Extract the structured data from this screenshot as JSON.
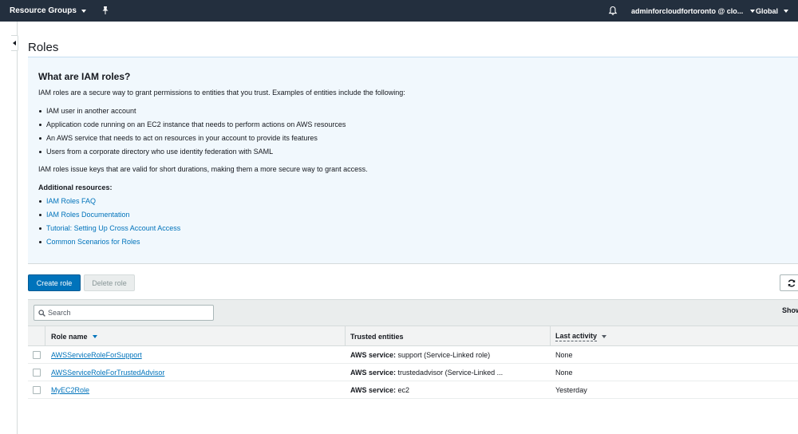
{
  "topnav": {
    "resource_groups": "Resource Groups",
    "account": "adminforcloudfortoronto @ clo...",
    "region": "Global"
  },
  "page": {
    "title": "Roles"
  },
  "info": {
    "heading": "What are IAM roles?",
    "intro": "IAM roles are a secure way to grant permissions to entities that you trust. Examples of entities include the following:",
    "entities": [
      "IAM user in another account",
      "Application code running on an EC2 instance that needs to perform actions on AWS resources",
      "An AWS service that needs to act on resources in your account to provide its features",
      "Users from a corporate directory who use identity federation with SAML"
    ],
    "keys_note": "IAM roles issue keys that are valid for short durations, making them a more secure way to grant access.",
    "resources_heading": "Additional resources:",
    "resources": [
      "IAM Roles FAQ",
      "IAM Roles Documentation",
      "Tutorial: Setting Up Cross Account Access",
      "Common Scenarios for Roles"
    ]
  },
  "actions": {
    "create_label": "Create role",
    "delete_label": "Delete role"
  },
  "table": {
    "search_placeholder": "Search",
    "show_label": "Show",
    "columns": [
      "Role name",
      "Trusted entities",
      "Last activity"
    ],
    "rows": [
      {
        "name": "AWSServiceRoleForSupport",
        "entity_label": "AWS service:",
        "entity_value": "support (Service-Linked role)",
        "last_activity": "None"
      },
      {
        "name": "AWSServiceRoleForTrustedAdvisor",
        "entity_label": "AWS service:",
        "entity_value": "trustedadvisor (Service-Linked ...",
        "last_activity": "None"
      },
      {
        "name": "MyEC2Role",
        "entity_label": "AWS service:",
        "entity_value": "ec2",
        "last_activity": "Yesterday"
      }
    ]
  },
  "colors": {
    "nav_bg": "#232f3e",
    "link": "#0073bb",
    "primary_button": "#0073bb",
    "info_bg": "#f1f8fd"
  },
  "icons": [
    "chevron-down-icon",
    "pin-icon",
    "bell-icon",
    "collapse-arrow-icon",
    "search-icon",
    "refresh-icon",
    "sort-icon"
  ]
}
